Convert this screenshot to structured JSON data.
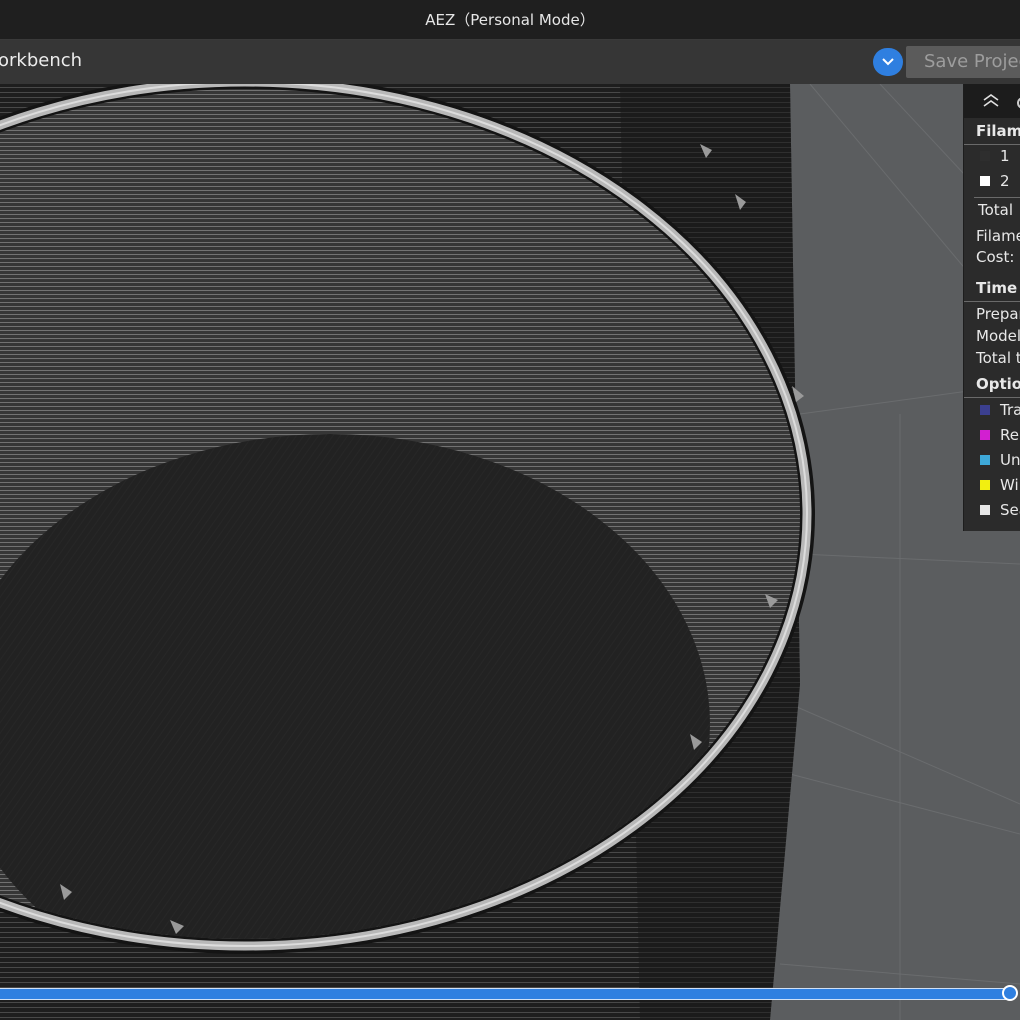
{
  "window": {
    "title": "AEZ（Personal Mode）"
  },
  "toolbar": {
    "workbench_label": "orkbench",
    "save_label": "Save Projec"
  },
  "stats": {
    "filament_heading": "Filame",
    "filaments": [
      {
        "label": "1",
        "color": "#2e2e2e"
      },
      {
        "label": "2",
        "color": "#ffffff"
      }
    ],
    "total_label": "Total",
    "filament_label": "Filame",
    "cost_label": "Cost:",
    "time_heading": "Time E",
    "prepare_label": "Prepar",
    "model_label": "Model",
    "total_time_label": "Total t",
    "options_heading": "Option",
    "options": [
      {
        "label": "Tra",
        "color": "#3b3f8f"
      },
      {
        "label": "Re",
        "color": "#d21fd1"
      },
      {
        "label": "Un",
        "color": "#3ea8d8"
      },
      {
        "label": "Wi",
        "color": "#f2ef10"
      },
      {
        "label": "Sea",
        "color": "#e6e6e6"
      }
    ]
  },
  "layer_slider": {
    "position_fraction": 1.0
  }
}
